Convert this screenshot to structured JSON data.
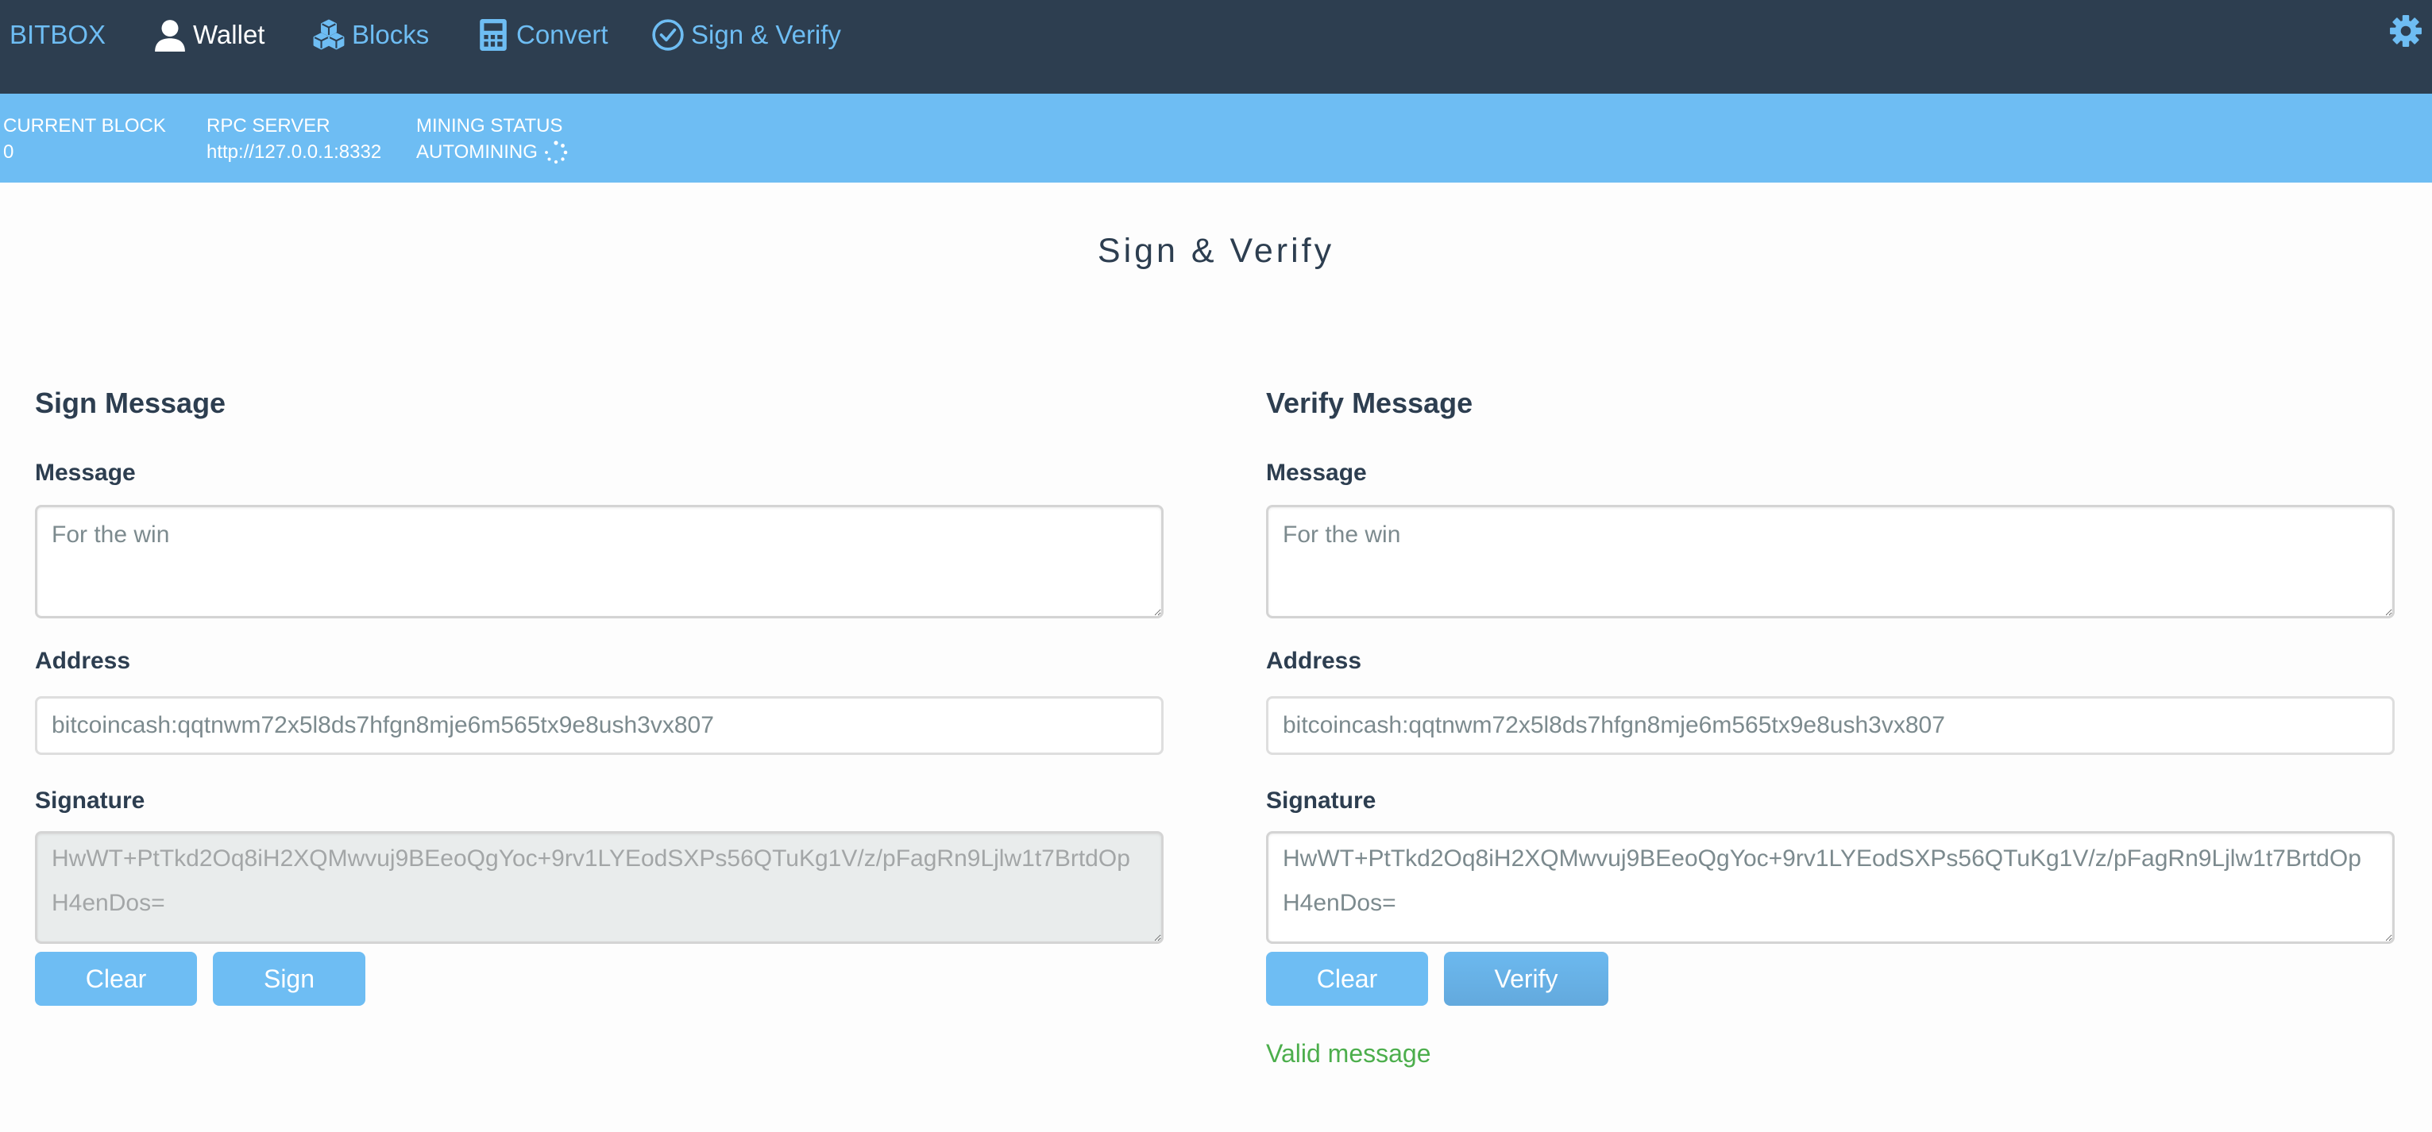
{
  "nav": {
    "brand": "BITBOX",
    "items": [
      {
        "label": "Wallet",
        "icon": "user-icon",
        "active": true
      },
      {
        "label": "Blocks",
        "icon": "cubes-icon",
        "active": false
      },
      {
        "label": "Convert",
        "icon": "calculator-icon",
        "active": false
      },
      {
        "label": "Sign & Verify",
        "icon": "check-circle-icon",
        "active": false
      }
    ],
    "settings_icon": "gear-icon"
  },
  "status": {
    "current_block_label": "CURRENT BLOCK",
    "current_block_value": "0",
    "rpc_server_label": "RPC SERVER",
    "rpc_server_value": "http://127.0.0.1:8332",
    "mining_status_label": "MINING STATUS",
    "mining_status_value": "AUTOMINING"
  },
  "page": {
    "title": "Sign & Verify"
  },
  "sign": {
    "heading": "Sign Message",
    "message_label": "Message",
    "message_value": "For the win",
    "address_label": "Address",
    "address_value": "bitcoincash:qqtnwm72x5l8ds7hfgn8mje6m565tx9e8ush3vx807",
    "signature_label": "Signature",
    "signature_value": "HwWT+PtTkd2Oq8iH2XQMwvuj9BEeoQgYoc+9rv1LYEodSXPs56QTuKg1V/z/pFagRn9Ljlw1t7BrtdOpH4enDos=",
    "clear_label": "Clear",
    "sign_label": "Sign"
  },
  "verify": {
    "heading": "Verify Message",
    "message_label": "Message",
    "message_value": "For the win",
    "address_label": "Address",
    "address_value": "bitcoincash:qqtnwm72x5l8ds7hfgn8mje6m565tx9e8ush3vx807",
    "signature_label": "Signature",
    "signature_value": "HwWT+PtTkd2Oq8iH2XQMwvuj9BEeoQgYoc+9rv1LYEodSXPs56QTuKg1V/z/pFagRn9Ljlw1t7BrtdOpH4enDos=",
    "clear_label": "Clear",
    "verify_label": "Verify",
    "result": "Valid message"
  },
  "colors": {
    "navbar_bg": "#2d3e50",
    "accent": "#6ebdf3",
    "text_dark": "#2d3e50",
    "success": "#4cae4c"
  }
}
